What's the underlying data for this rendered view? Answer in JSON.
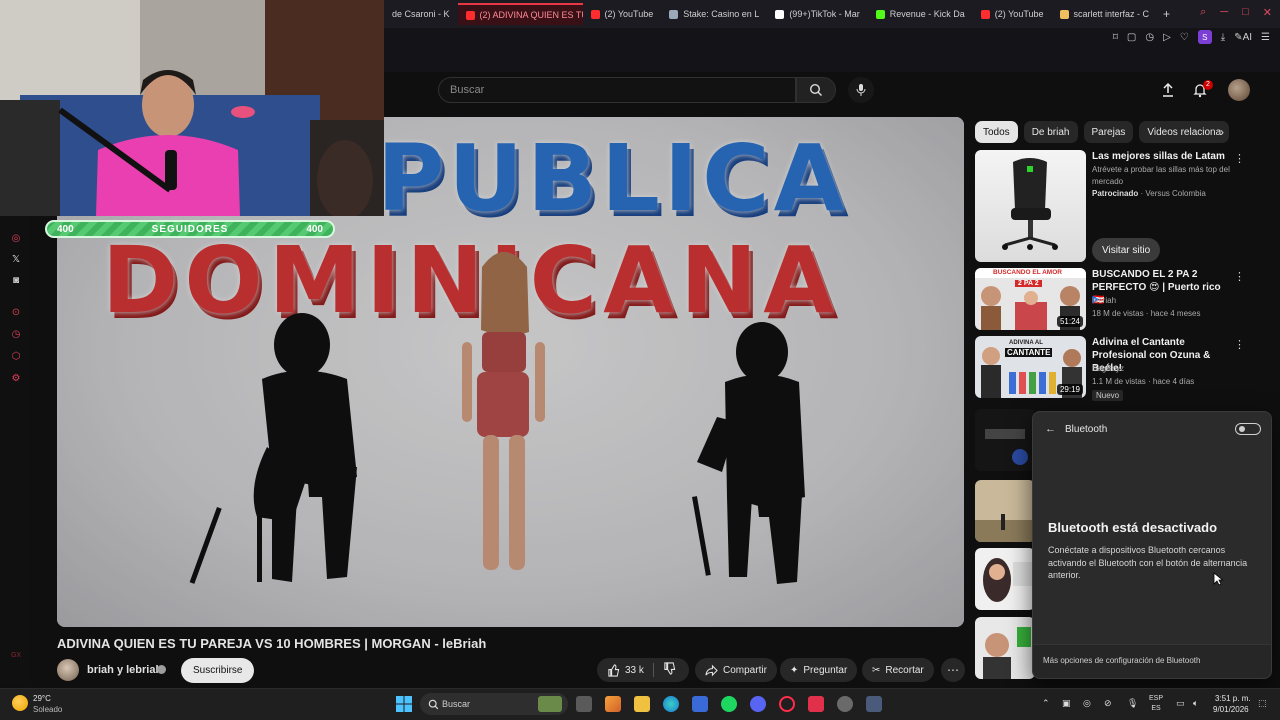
{
  "browser": {
    "tabs": [
      {
        "label": "de Csaroni - K",
        "color": "#53fc18",
        "active": false
      },
      {
        "label": "(2) ADIVINA QUIEN ES TU",
        "color": "#ff2d2d",
        "active": true
      },
      {
        "label": "(2) YouTube",
        "color": "#ff2d2d",
        "active": false
      },
      {
        "label": "Stake: Casino en L",
        "color": "#9aa8b8",
        "active": false
      },
      {
        "label": "(99+)TikTok - Mar",
        "color": "#ffffff",
        "active": false
      },
      {
        "label": "Revenue - Kick Da",
        "color": "#53fc18",
        "active": false
      },
      {
        "label": "(2) YouTube",
        "color": "#ff2d2d",
        "active": false
      },
      {
        "label": "scarlett interfaz - C",
        "color": "#f0c060",
        "active": false
      }
    ],
    "ai_label": "AI",
    "profile_badge": "S"
  },
  "youtube": {
    "search_placeholder": "Buscar",
    "notification_count": "2"
  },
  "overlay": {
    "followers_left": "400",
    "followers_label": "SEGUIDORES",
    "followers_right": "400"
  },
  "video": {
    "frame_text_line1": "PUBLICA",
    "frame_text_line2": "DOMINICANA",
    "title": "ADIVINA QUIEN ES TU PAREJA VS 10 HOMBRES | MORGAN - leBriah",
    "channel": "briah y lebriah",
    "subscribe_label": "Suscribirse",
    "likes": "33 k",
    "share_label": "Compartir",
    "ask_label": "Preguntar",
    "clip_label": "Recortar"
  },
  "sidebar": {
    "chips": [
      "Todos",
      "De briah",
      "Parejas",
      "Videos relaciona"
    ],
    "ad": {
      "title": "Las mejores sillas de Latam",
      "description": "Atrévete a probar las sillas más top del mercado",
      "sponsored_label": "Patrocinado",
      "advertiser": "Versus Colombia",
      "cta": "Visitar sitio"
    },
    "recommendations": [
      {
        "title": "BUSCANDO EL 2 PA 2 PERFECTO 😍 | Puerto rico 🇵🇷",
        "channel": "lebriah",
        "meta": "18 M de vistas · hace 4 meses",
        "duration": "51:24",
        "badge": ""
      },
      {
        "title": "Adivina el Cantante Profesional con Ozuna & Beéle!",
        "channel": "BagBoyz",
        "meta": "1.1 M de vistas · hace 4 días",
        "duration": "29:19",
        "badge": "Nuevo"
      }
    ],
    "thumb_texts": [
      "BUSCANDO EL AMOR",
      "2 PA 2",
      "ADIVINA AL",
      "CANTANTE"
    ]
  },
  "bluetooth": {
    "title": "Bluetooth",
    "heading": "Bluetooth está desactivado",
    "description": "Conéctate a dispositivos Bluetooth cercanos activando el Bluetooth con el botón de alternancia anterior.",
    "more_settings": "Más opciones de configuración de Bluetooth",
    "enabled": false
  },
  "taskbar": {
    "temperature": "29°C",
    "weather": "Soleado",
    "search_placeholder": "Buscar",
    "lang_line1": "ESP",
    "lang_line2": "ES",
    "time": "3:51 p. m.",
    "date": "9/01/2026"
  },
  "colors": {
    "accent": "#e63946",
    "follow_bar": "#3fb35b",
    "youtube_red": "#ff0000"
  }
}
